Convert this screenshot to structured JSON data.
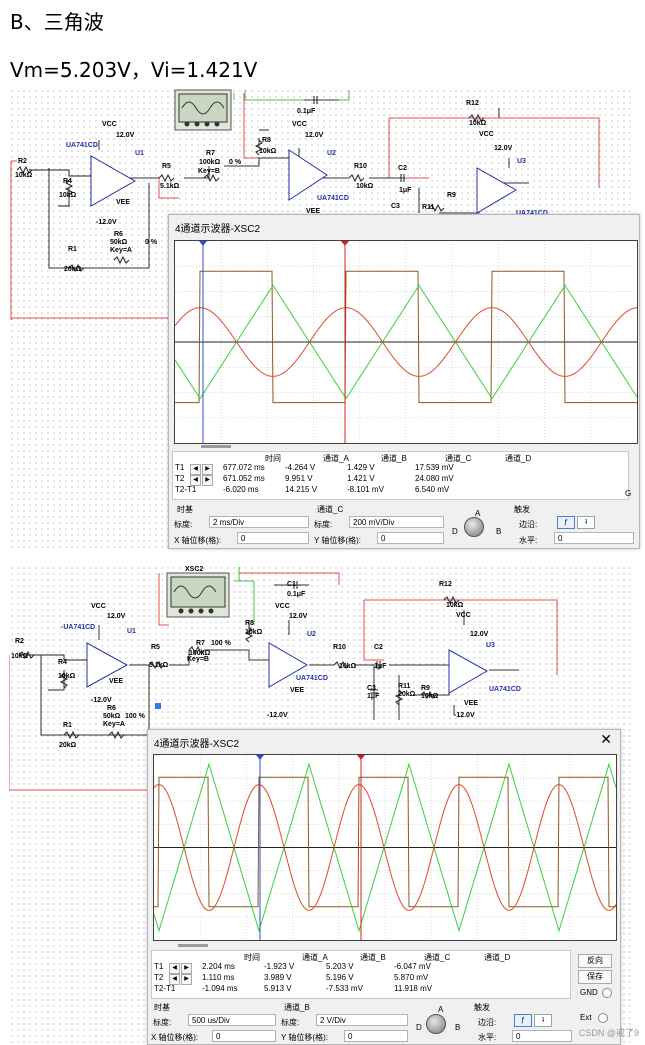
{
  "heading": "B、三角波",
  "subheading": "Vm=5.203V，Vi=1.421V",
  "schematic1": {
    "labels": [
      "VCC",
      "12.0V",
      "UA741CD",
      "U1",
      "R2",
      "10kΩ",
      "R4",
      "10kΩ",
      "-12.0V",
      "VEE",
      "R1",
      "20kΩ",
      "R6",
      "50kΩ",
      "Key=A",
      "0 %",
      "R5",
      "5.1kΩ",
      "R7",
      "100kΩ",
      "Key=B",
      "0 %",
      "R8",
      "10kΩ",
      "VCC",
      "12.0V",
      "U2",
      "UA741CD",
      "VEE",
      "0.1μF",
      "R10",
      "10kΩ",
      "C2",
      "1μF",
      "C3",
      "R11",
      "R9",
      "R12",
      "10kΩ",
      "VCC",
      "12.0V",
      "U3",
      "UA741CD"
    ]
  },
  "scope1": {
    "title": "4通道示波器-XSC2",
    "headers": [
      "时间",
      "通道_A",
      "通道_B",
      "通道_C",
      "通道_D"
    ],
    "rows": [
      {
        "label": "T1",
        "time": "677.072 ms",
        "a": "-4.264 V",
        "b": "1.429 V",
        "c": "17.539 mV"
      },
      {
        "label": "T2",
        "time": "671.052 ms",
        "a": "9.951 V",
        "b": "1.421 V",
        "c": "24.080 mV"
      },
      {
        "label": "T2-T1",
        "time": "-6.020 ms",
        "a": "14.215 V",
        "b": "-8.101 mV",
        "c": "6.540 mV"
      }
    ],
    "timebase_label": "时基",
    "scale_label": "标度:",
    "timebase_scale": "2 ms/Div",
    "xpos_label": "X 轴位移(格):",
    "xpos": "0",
    "channel_label": "通道_C",
    "channel_scale": "200 mV/Div",
    "ypos_label": "Y 轴位移(格):",
    "ypos": "0",
    "knob_a": "A",
    "knob_b": "B",
    "knob_d": "D",
    "trigger_label": "触发",
    "edge_label": "边沿:",
    "level_label": "水平:",
    "level": "0",
    "g_label": "G"
  },
  "schematic2": {
    "labels": [
      "XSC2",
      "C1",
      "0.1μF",
      "R12",
      "10kΩ",
      "VCC",
      "12.0V",
      "-UA741CD",
      "U1",
      "R2",
      "10kΩ",
      "R4",
      "10kΩ",
      "-12.0V",
      "VEE",
      "R5",
      "5.1kΩ",
      "R7",
      "100kΩ",
      "100 %",
      "Key=B",
      "R8",
      "10kΩ",
      "VCC",
      "12.0V",
      "U2",
      "UA741CD",
      "VEE",
      "-12.0V",
      "R10",
      "10kΩ",
      "C2",
      "1μF",
      "C3",
      "1μF",
      "R11",
      "20kΩ",
      "R9",
      "10kΩ",
      "VCC",
      "12.0V",
      "U3",
      "UA741CD",
      "VEE",
      "-12.0V",
      "R1",
      "20kΩ",
      "R6",
      "50kΩ",
      "100 %",
      "Key=A"
    ]
  },
  "scope2": {
    "title": "4通道示波器-XSC2",
    "close": "✕",
    "headers": [
      "时间",
      "通道_A",
      "通道_B",
      "通道_C",
      "通道_D"
    ],
    "rows": [
      {
        "label": "T1",
        "time": "2.204 ms",
        "a": "-1.923 V",
        "b": "5.203 V",
        "c": "-6.047 mV"
      },
      {
        "label": "T2",
        "time": "1.110 ms",
        "a": "3.989 V",
        "b": "5.196 V",
        "c": "5.870 mV"
      },
      {
        "label": "T2-T1",
        "time": "-1.094 ms",
        "a": "5.913 V",
        "b": "-7.533 mV",
        "c": "11.918 mV"
      }
    ],
    "reverse": "反向",
    "save": "保存",
    "gnd": "GND",
    "timebase_label": "时基",
    "scale_label": "标度:",
    "timebase_scale": "500 us/Div",
    "xpos_label": "X 轴位移(格):",
    "xpos": "0",
    "channel_label": "通道_B",
    "channel_scale": "2  V/Div",
    "ypos_label": "Y 轴位移(格):",
    "ypos": "0",
    "knob_a": "A",
    "knob_b": "B",
    "knob_d": "D",
    "trigger_label": "触发",
    "edge_label": "边沿:",
    "level_label": "水平:",
    "level": "0",
    "ext_label": "Ext"
  },
  "watermark": "CSDN @戒了9",
  "colors": {
    "ch_a": "#8b5a1e",
    "ch_b": "#e04a2a",
    "ch_c": "#3ccf3c",
    "cursor_t1": "#2b4fd6",
    "cursor_t2": "#d82020"
  }
}
